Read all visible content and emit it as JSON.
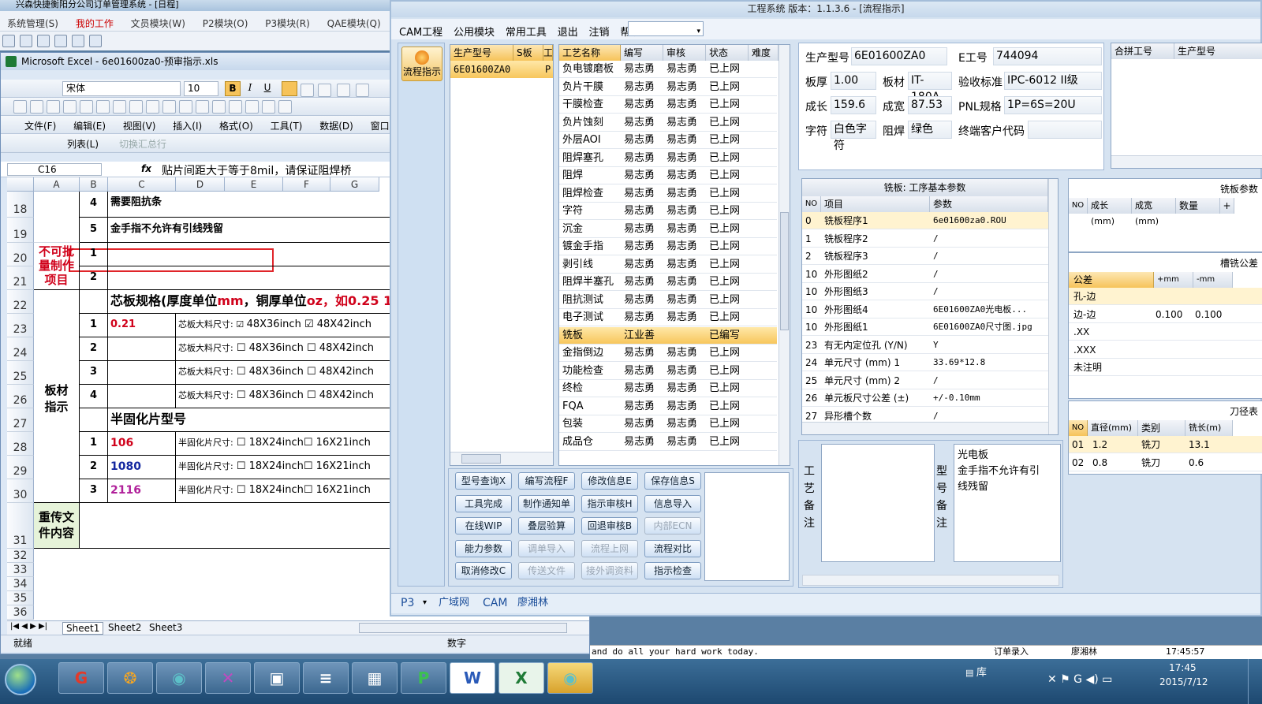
{
  "back_app": {
    "title": "兴森快捷衡阳分公司订单管理系统 - [日程]",
    "menu": [
      "系统管理(S)",
      "我的工作",
      "文员模块(W)",
      "P2模块(O)",
      "P3模块(R)",
      "QAE模块(Q)"
    ]
  },
  "excel": {
    "title": "Microsoft Excel - 6e01600za0-预审指示.xls",
    "font_name": "宋体",
    "font_size": "10",
    "menu": [
      "文件(F)",
      "编辑(E)",
      "视图(V)",
      "插入(I)",
      "格式(O)",
      "工具(T)",
      "数据(D)",
      "窗口(W)",
      "帮"
    ],
    "list_label": "列表(L)",
    "toggle_total": "切换汇总行",
    "cell_ref": "C16",
    "fx": "fx",
    "formula": "贴片间距大于等于8mil，请保证阻焊桥",
    "columns": [
      "A",
      "B",
      "C",
      "D",
      "E",
      "F",
      "G"
    ],
    "rows": [
      "18",
      "19",
      "20",
      "21",
      "22",
      "23",
      "24",
      "25",
      "26",
      "27",
      "28",
      "29",
      "30",
      "31",
      "32",
      "33",
      "34",
      "35",
      "36"
    ],
    "r18": {
      "num": "4",
      "text": "需要阻抗条"
    },
    "r19": {
      "num": "5",
      "text": "金手指不允许有引线残留"
    },
    "r20": {
      "label": "不可批量制作项目",
      "num1": "1",
      "num2": "2"
    },
    "r22": {
      "title_black": "芯板规格(厚度单位",
      "title_mm": "mm",
      "title_mid": "，铜厚单位",
      "title_oz": "oz",
      "title_tail": "，如0.25 1/"
    },
    "core": {
      "label": "芯板大料尺寸:",
      "first_thick": "0.21",
      "opt1": "48X36inch",
      "opt2": "48X42inch",
      "nums": [
        "1",
        "2",
        "3",
        "4"
      ]
    },
    "board_label": "板材指示",
    "pp_title": "半固化片型号",
    "pp": {
      "label": "半固化片尺寸:",
      "opt1": "18X24inch",
      "opt2": "16X21inch",
      "rows": [
        {
          "num": "1",
          "type": "106",
          "color": "#d0021b"
        },
        {
          "num": "2",
          "type": "1080",
          "color": "#1428a0"
        },
        {
          "num": "3",
          "type": "2116",
          "color": "#b0209a"
        }
      ]
    },
    "reload_label": "重传文件内容",
    "sheets": [
      "Sheet1",
      "Sheet2",
      "Sheet3"
    ],
    "status_ready": "就绪",
    "status_num": "数字"
  },
  "cam": {
    "title": "工程系统  版本：1.1.3.6 - [流程指示]",
    "menu": [
      "CAM工程",
      "公用模块",
      "常用工具",
      "退出",
      "注销",
      "帮助"
    ],
    "flow_label": "流程指示",
    "model_list": {
      "headers": [
        "生产型号",
        "S板",
        "工"
      ],
      "items": [
        {
          "model": "6E01600ZA0",
          "flag": "P"
        }
      ]
    },
    "process": {
      "headers": [
        "工艺名称",
        "编写",
        "审核",
        "状态",
        "难度"
      ],
      "rows": [
        {
          "name": "负电镀磨板",
          "w": "易志勇",
          "r": "易志勇",
          "s": "已上网"
        },
        {
          "name": "负片干膜",
          "w": "易志勇",
          "r": "易志勇",
          "s": "已上网"
        },
        {
          "name": "干膜检查",
          "w": "易志勇",
          "r": "易志勇",
          "s": "已上网"
        },
        {
          "name": "负片蚀刻",
          "w": "易志勇",
          "r": "易志勇",
          "s": "已上网"
        },
        {
          "name": "外层AOI",
          "w": "易志勇",
          "r": "易志勇",
          "s": "已上网"
        },
        {
          "name": "阻焊塞孔",
          "w": "易志勇",
          "r": "易志勇",
          "s": "已上网"
        },
        {
          "name": "阻焊",
          "w": "易志勇",
          "r": "易志勇",
          "s": "已上网"
        },
        {
          "name": "阻焊检查",
          "w": "易志勇",
          "r": "易志勇",
          "s": "已上网"
        },
        {
          "name": "字符",
          "w": "易志勇",
          "r": "易志勇",
          "s": "已上网"
        },
        {
          "name": "沉金",
          "w": "易志勇",
          "r": "易志勇",
          "s": "已上网"
        },
        {
          "name": "镀金手指",
          "w": "易志勇",
          "r": "易志勇",
          "s": "已上网"
        },
        {
          "name": "剥引线",
          "w": "易志勇",
          "r": "易志勇",
          "s": "已上网"
        },
        {
          "name": "阻焊半塞孔",
          "w": "易志勇",
          "r": "易志勇",
          "s": "已上网"
        },
        {
          "name": "阻抗测试",
          "w": "易志勇",
          "r": "易志勇",
          "s": "已上网"
        },
        {
          "name": "电子测试",
          "w": "易志勇",
          "r": "易志勇",
          "s": "已上网"
        },
        {
          "name": "铣板",
          "w": "江业善",
          "r": "",
          "s": "已编写"
        },
        {
          "name": "金指倒边",
          "w": "易志勇",
          "r": "易志勇",
          "s": "已上网"
        },
        {
          "name": "功能检查",
          "w": "易志勇",
          "r": "易志勇",
          "s": "已上网"
        },
        {
          "name": "终检",
          "w": "易志勇",
          "r": "易志勇",
          "s": "已上网"
        },
        {
          "name": "FQA",
          "w": "易志勇",
          "r": "易志勇",
          "s": "已上网"
        },
        {
          "name": "包装",
          "w": "易志勇",
          "r": "易志勇",
          "s": "已上网"
        },
        {
          "name": "成品仓",
          "w": "易志勇",
          "r": "易志勇",
          "s": "已上网"
        }
      ]
    },
    "buttons": [
      [
        "型号查询X",
        "编写流程F",
        "修改信息E",
        "保存信息S"
      ],
      [
        "工具完成",
        "制作通知单",
        "指示审核H",
        "信息导入"
      ],
      [
        "在线WIP",
        "叠层验算",
        "回退审核B",
        "内部ECN"
      ],
      [
        "能力参数",
        "调单导入",
        "流程上网",
        "流程对比"
      ],
      [
        "取消修改C",
        "传送文件",
        "接外调资料",
        "指示检查"
      ]
    ],
    "disabled_buttons": [
      "内部ECN",
      "调单导入",
      "流程上网",
      "传送文件",
      "接外调资料"
    ],
    "info": {
      "model_lbl": "生产型号",
      "model": "6E01600ZA0",
      "eno_lbl": "E工号",
      "eno": "744094",
      "thick_lbl": "板厚",
      "thick": "1.00",
      "mat_lbl": "板材",
      "mat": "IT-180A",
      "std_lbl": "验收标准",
      "std": "IPC-6012 II级",
      "len_lbl": "成长",
      "len": "159.6",
      "wid_lbl": "成宽",
      "wid": "87.53",
      "pnl_lbl": "PNL规格",
      "pnl": "1P=6S=20U",
      "char_lbl": "字符",
      "char": "白色字符",
      "mask_lbl": "阻焊",
      "mask": "绿色",
      "cust_lbl": "终端客户代码",
      "cust": ""
    },
    "merge": {
      "headers": [
        "合拼工号",
        "生产型号"
      ]
    },
    "params": {
      "title": "铣板: 工序基本参数",
      "headers": [
        "NO",
        "项目",
        "参数"
      ],
      "rows": [
        {
          "no": "0",
          "item": "铣板程序1",
          "val": "6e01600za0.ROU"
        },
        {
          "no": "1",
          "item": "铣板程序2",
          "val": "/"
        },
        {
          "no": "2",
          "item": "铣板程序3",
          "val": "/"
        },
        {
          "no": "10",
          "item": "外形图纸2",
          "val": "/"
        },
        {
          "no": "10",
          "item": "外形图纸3",
          "val": "/"
        },
        {
          "no": "10",
          "item": "外形图纸4",
          "val": "6E01600ZA0光电板..."
        },
        {
          "no": "10",
          "item": "外形图纸1",
          "val": "6E01600ZA0尺寸图.jpg"
        },
        {
          "no": "23",
          "item": "有无内定位孔 (Y/N)",
          "val": "Y"
        },
        {
          "no": "24",
          "item": "单元尺寸 (mm) 1",
          "val": "33.69*12.8"
        },
        {
          "no": "25",
          "item": "单元尺寸 (mm) 2",
          "val": "/"
        },
        {
          "no": "26",
          "item": "单元板尺寸公差 (±)",
          "val": "+/-0.10mm"
        },
        {
          "no": "27",
          "item": "异形槽个数",
          "val": "/"
        }
      ]
    },
    "mill_params": {
      "title": "铣板参数",
      "headers": [
        "NO",
        "成长(mm)",
        "成宽(mm)",
        "数量",
        "+"
      ]
    },
    "slot_tol": {
      "title": "槽铣公差",
      "headers": [
        "公差",
        "+mm",
        "-mm"
      ],
      "rows": [
        {
          "name": "孔-边",
          "p": "",
          "m": ""
        },
        {
          "name": "边-边",
          "p": "0.100",
          "m": "0.100"
        },
        {
          "name": ".XX",
          "p": "",
          "m": ""
        },
        {
          "name": ".XXX",
          "p": "",
          "m": ""
        },
        {
          "name": "未注明",
          "p": "",
          "m": ""
        }
      ]
    },
    "tools": {
      "title": "刀径表",
      "headers": [
        "NO",
        "直径(mm)",
        "类别",
        "铣长(m)"
      ],
      "rows": [
        {
          "no": "01",
          "d": "1.2",
          "t": "铣刀",
          "l": "13.1"
        },
        {
          "no": "02",
          "d": "0.8",
          "t": "铣刀",
          "l": "0.6"
        }
      ]
    },
    "remarks": {
      "process_label": "工艺备注",
      "model_label": "型号备注",
      "model_text_1": "光电板",
      "model_text_2": "金手指不允许有引线残留"
    },
    "status": {
      "p3": "P3",
      "net": "广域网",
      "cam": "CAM",
      "user": "廖湘林"
    }
  },
  "outer_status": {
    "msg": "and do all your hard work today.",
    "order": "订单录入",
    "user": "廖湘林",
    "time": "17:45:57"
  },
  "taskbar": {
    "ime": "库",
    "time": "17:45",
    "date": "2015/7/12"
  }
}
